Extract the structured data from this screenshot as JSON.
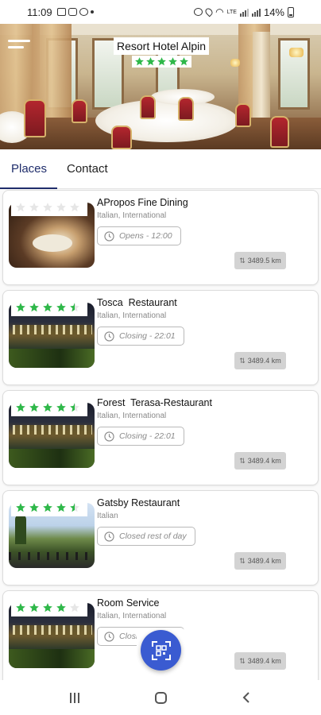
{
  "status_bar": {
    "time": "11:09",
    "network_label": "LTE",
    "battery": "14%"
  },
  "header": {
    "hotel_name": "Resort Hotel Alpin",
    "rating": 5
  },
  "tabs": [
    {
      "label": "Places",
      "active": true
    },
    {
      "label": "Contact",
      "active": false
    }
  ],
  "places": [
    {
      "name": "APropos Fine Dining",
      "cuisine": "Italian, International",
      "status": "Opens - 12:00",
      "distance": "3489.5 km",
      "rating": 0,
      "image": "fine-dining-interior"
    },
    {
      "name": "Tosca  Restaurant",
      "cuisine": "Italian, International",
      "status": "Closing - 22:01",
      "distance": "3489.4 km",
      "rating": 4.5,
      "image": "night-terrace"
    },
    {
      "name": "Forest  Terasa-Restaurant",
      "cuisine": "Italian, International",
      "status": "Closing - 22:01",
      "distance": "3489.4 km",
      "rating": 4.5,
      "image": "night-terrace"
    },
    {
      "name": "Gatsby Restaurant",
      "cuisine": "Italian",
      "status": "Closed rest of day",
      "distance": "3489.4 km",
      "rating": 4.5,
      "image": "day-terrace"
    },
    {
      "name": "Room Service",
      "cuisine": "Italian, International",
      "status": "Closing - 22:01",
      "distance": "3489.4 km",
      "rating": 4,
      "image": "night-terrace"
    }
  ],
  "colors": {
    "star": "#2fb84a",
    "star_empty": "#e6e6e6",
    "tab_active": "#1f2d6b",
    "fab": "#3a5bd1"
  },
  "icons": {
    "menu": "hamburger-menu-icon",
    "clock": "clock-icon",
    "distance": "up-down-arrow-icon",
    "fab": "qr-scan-icon",
    "nav_recents": "recents-icon",
    "nav_home": "home-icon",
    "nav_back": "back-icon"
  }
}
